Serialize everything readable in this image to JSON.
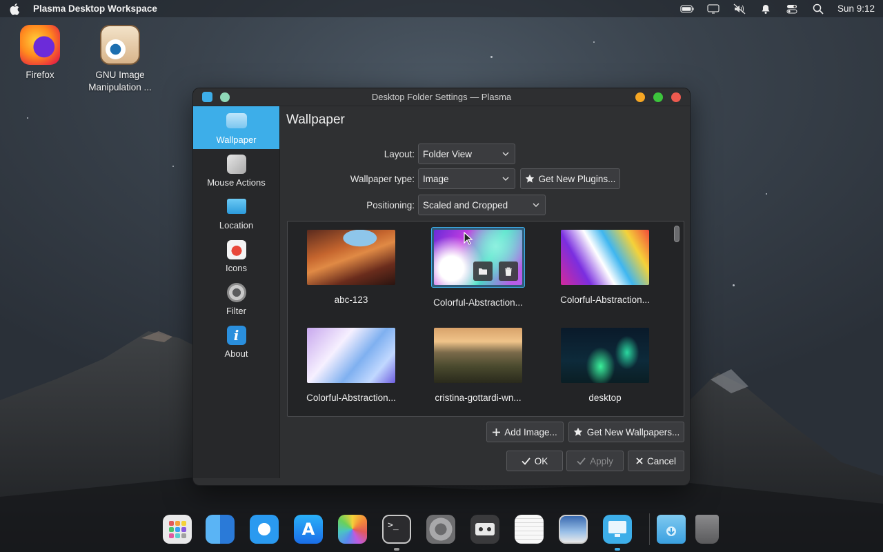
{
  "topbar": {
    "app_title": "Plasma Desktop Workspace",
    "clock": "Sun 9:12"
  },
  "desktop_icons": [
    {
      "label": "Firefox"
    },
    {
      "label": "GNU Image Manipulation ..."
    }
  ],
  "window": {
    "title": "Desktop Folder Settings — Plasma",
    "sidebar": [
      {
        "label": "Wallpaper",
        "active": true
      },
      {
        "label": "Mouse Actions"
      },
      {
        "label": "Location"
      },
      {
        "label": "Icons"
      },
      {
        "label": "Filter"
      },
      {
        "label": "About"
      }
    ],
    "page_title": "Wallpaper",
    "layout_label": "Layout:",
    "layout_value": "Folder View",
    "wallpaper_type_label": "Wallpaper type:",
    "wallpaper_type_value": "Image",
    "get_plugins_label": "Get New Plugins...",
    "positioning_label": "Positioning:",
    "positioning_value": "Scaled and Cropped",
    "wallpapers": [
      {
        "label": "abc-123"
      },
      {
        "label": "Colorful-Abstraction...",
        "selected": true
      },
      {
        "label": "Colorful-Abstraction..."
      },
      {
        "label": "Colorful-Abstraction..."
      },
      {
        "label": "cristina-gottardi-wn..."
      },
      {
        "label": "desktop"
      }
    ],
    "add_image_label": "Add Image...",
    "get_wallpapers_label": "Get New Wallpapers...",
    "ok_label": "OK",
    "apply_label": "Apply",
    "cancel_label": "Cancel"
  },
  "colors": {
    "accent": "#3daee9",
    "close": "#ed5a4f",
    "minimize": "#f5a623",
    "maximize": "#3cc43c"
  }
}
